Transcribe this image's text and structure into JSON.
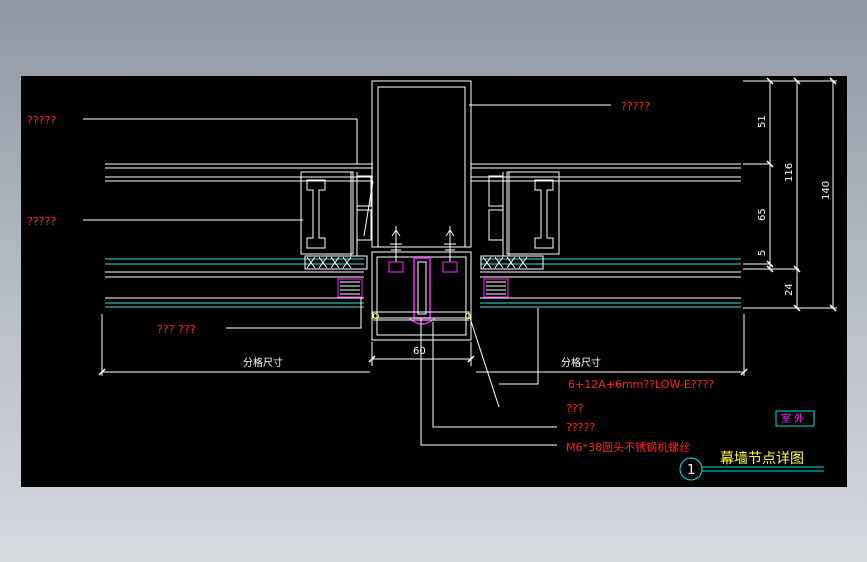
{
  "labels": {
    "left_top": "?????",
    "left_mid": "?????",
    "left_bottom": "??? ???",
    "right_top": "?????",
    "glass_spec": "6+12A+6mm??LOW-E????",
    "callout_a": "???",
    "callout_b": "?????",
    "screw_spec": "M6*38圆头不锈钢机螺丝"
  },
  "dimensions": {
    "width_60": "60",
    "left_span": "分格尺寸",
    "right_span": "分格尺寸",
    "d51": "51",
    "d116": "116",
    "d140": "140",
    "d65": "65",
    "d5": "5",
    "d24": "24"
  },
  "outdoor_tag": "室 外",
  "detail": {
    "number": "1",
    "title": "幕墙节点详图"
  },
  "colors": {
    "background": "#000000",
    "profile": "#ffffff",
    "label_red": "#ff2020",
    "glass_cyan": "#40e0d0",
    "magenta": "#ff20ff",
    "title_yellow": "#ffff40",
    "tag_cyan": "#00e0e0"
  }
}
